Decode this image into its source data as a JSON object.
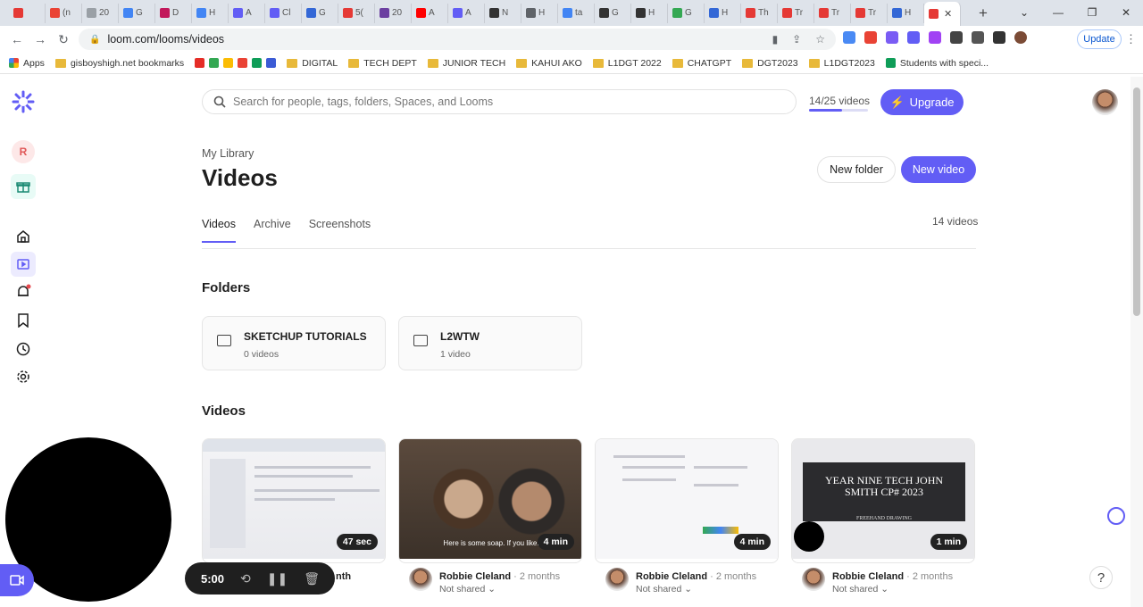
{
  "browser": {
    "tabs": [
      "",
      "(n",
      "20",
      "G",
      "D",
      "H",
      "A",
      "Cl",
      "G",
      "5(",
      "20",
      "A",
      "A",
      "N",
      "H",
      "ta",
      "G",
      "H",
      "G",
      "H",
      "Th",
      "Tr",
      "Tr",
      "Tr",
      "H",
      ""
    ],
    "url": "loom.com/looms/videos",
    "update_label": "Update",
    "bookmarks": [
      "Apps",
      "gisboyshigh.net bookmarks",
      "DIGITAL",
      "TECH DEPT",
      "JUNIOR TECH",
      "KAHUI AKO",
      "L1DGT 2022",
      "CHATGPT",
      "DGT2023",
      "L1DGT2023",
      "Students with speci..."
    ]
  },
  "header": {
    "search_placeholder": "Search for people, tags, folders, Spaces, and Looms",
    "video_count": "14/25 videos",
    "video_quota_fraction": 0.56,
    "upgrade_label": "Upgrade"
  },
  "page": {
    "breadcrumb": "My Library",
    "title": "Videos",
    "new_folder_label": "New folder",
    "new_video_label": "New video",
    "tabs": [
      "Videos",
      "Archive",
      "Screenshots"
    ],
    "total_videos": "14 videos",
    "folders_heading": "Folders",
    "videos_heading": "Videos"
  },
  "sidebar": {
    "workspace_initial": "R"
  },
  "folders": [
    {
      "name": "SKETCHUP TUTORIALS",
      "count": "0 videos"
    },
    {
      "name": "L2WTW",
      "count": "1 video"
    }
  ],
  "videos": [
    {
      "duration": "47 sec",
      "author": "",
      "age": "nth",
      "share": "",
      "title": ""
    },
    {
      "duration": "4 min",
      "author": "Robbie Cleland",
      "age": "· 2 months",
      "share": "Not shared ⌄",
      "title": "",
      "caption": "Here is some soap. If you like."
    },
    {
      "duration": "4 min",
      "author": "Robbie Cleland",
      "age": "· 2 months",
      "share": "Not shared ⌄",
      "title": ""
    },
    {
      "duration": "1 min",
      "author": "Robbie Cleland",
      "age": "· 2 months",
      "share": "Not shared ⌄",
      "title": "",
      "thumb_title": "YEAR NINE TECH JOHN SMITH CP# 2023",
      "thumb_sub": "FREEHAND DRAWING"
    }
  ],
  "recorder": {
    "time": "5:00"
  },
  "help_label": "?",
  "colors": {
    "accent": "#625df5"
  }
}
